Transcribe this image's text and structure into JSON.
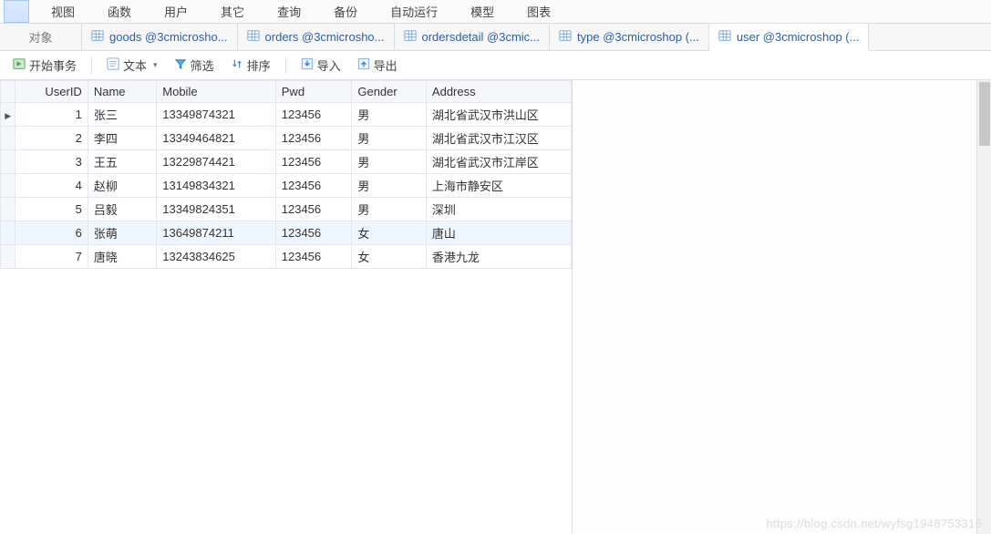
{
  "menubar": {
    "items": [
      "视图",
      "函数",
      "用户",
      "其它",
      "查询",
      "备份",
      "自动运行",
      "模型",
      "图表"
    ]
  },
  "tabs": {
    "object_label": "对象",
    "items": [
      {
        "label": "goods @3cmicrosho...",
        "active": false
      },
      {
        "label": "orders @3cmicrosho...",
        "active": false
      },
      {
        "label": "ordersdetail @3cmic...",
        "active": false
      },
      {
        "label": "type @3cmicroshop (...",
        "active": false
      },
      {
        "label": "user @3cmicroshop (...",
        "active": true
      }
    ]
  },
  "toolbar": {
    "begin_trans": "开始事务",
    "text": "文本",
    "filter": "筛选",
    "sort": "排序",
    "import": "导入",
    "export": "导出"
  },
  "grid": {
    "columns": [
      "UserID",
      "Name",
      "Mobile",
      "Pwd",
      "Gender",
      "Address"
    ],
    "rows": [
      {
        "UserID": "1",
        "Name": "张三",
        "Mobile": "13349874321",
        "Pwd": "123456",
        "Gender": "男",
        "Address": "湖北省武汉市洪山区",
        "current": true
      },
      {
        "UserID": "2",
        "Name": "李四",
        "Mobile": "13349464821",
        "Pwd": "123456",
        "Gender": "男",
        "Address": "湖北省武汉市江汉区"
      },
      {
        "UserID": "3",
        "Name": "王五",
        "Mobile": "13229874421",
        "Pwd": "123456",
        "Gender": "男",
        "Address": "湖北省武汉市江岸区"
      },
      {
        "UserID": "4",
        "Name": "赵柳",
        "Mobile": "13149834321",
        "Pwd": "123456",
        "Gender": "男",
        "Address": "上海市静安区"
      },
      {
        "UserID": "5",
        "Name": "吕毅",
        "Mobile": "13349824351",
        "Pwd": "123456",
        "Gender": "男",
        "Address": "深圳"
      },
      {
        "UserID": "6",
        "Name": "张萌",
        "Mobile": "13649874211",
        "Pwd": "123456",
        "Gender": "女",
        "Address": "唐山",
        "highlight": true
      },
      {
        "UserID": "7",
        "Name": "唐晓",
        "Mobile": "13243834625",
        "Pwd": "123456",
        "Gender": "女",
        "Address": "香港九龙"
      }
    ]
  },
  "watermark": "https://blog.csdn.net/wyfsg1948753316"
}
